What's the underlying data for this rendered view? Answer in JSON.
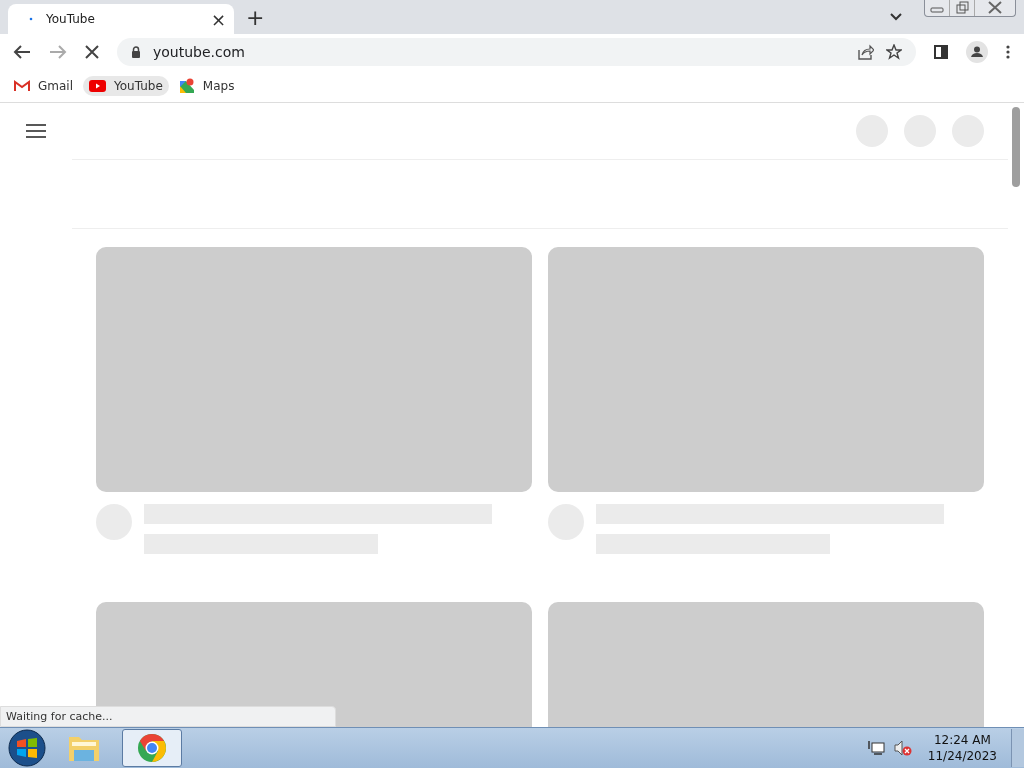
{
  "browser": {
    "tab": {
      "title": "YouTube",
      "close": "×",
      "loading": true
    },
    "new_tab": "+",
    "address": {
      "url": "youtube.com"
    },
    "loading": true,
    "bookmarks": [
      {
        "label": "Gmail",
        "kind": "gmail",
        "hovered": false
      },
      {
        "label": "YouTube",
        "kind": "youtube",
        "hovered": true
      },
      {
        "label": "Maps",
        "kind": "maps",
        "hovered": false
      }
    ],
    "status_bubble": "Waiting for cache..."
  },
  "taskbar": {
    "apps": [
      {
        "kind": "explorer",
        "selected": false
      },
      {
        "kind": "chrome",
        "selected": true
      }
    ],
    "clock": {
      "time": "12:24 AM",
      "date": "11/24/2023"
    }
  }
}
